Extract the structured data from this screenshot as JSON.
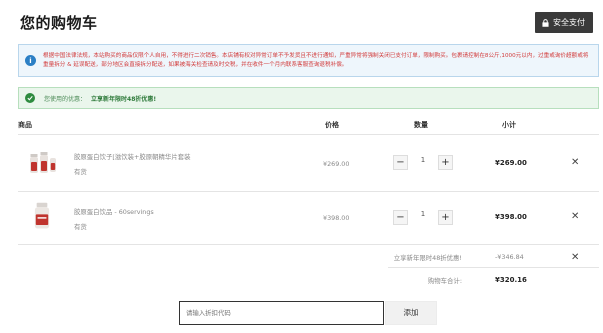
{
  "header": {
    "title": "您的购物车",
    "checkout_label": "安全支付"
  },
  "notice": {
    "icon": "info-icon",
    "text": "根据中国法律法规，本站购买的商品仅限个人自用，不得进行二次销售。本店铺有权对异常订单不予发货且不进行通知，严重异常将强制关闭已支付订单，限制购买。包裹请控制在8公斤,1000元以内，过重或询价超额或将重量拆分 & 延误配送，部分地区会直接拆分配送，如果被海关检查请及时交税，并在收件一个月内联系客服查询退税补偿。"
  },
  "coupon_message": {
    "label": "您使用的优惠：",
    "code": "立享新年限时48折优惠!"
  },
  "table": {
    "headers": {
      "product": "商品",
      "price": "价格",
      "quantity": "数量",
      "subtotal": "小计"
    }
  },
  "items": [
    {
      "name": "胶原蛋白饮子[滋饮装+胶原朝精华片套装",
      "meta": "有货",
      "price": "¥269.00",
      "quantity": "1",
      "subtotal": "¥269.00",
      "thumb_color": "#c0342e"
    },
    {
      "name": "胶原蛋白饮品 - 60servings",
      "meta": "有货",
      "price": "¥398.00",
      "quantity": "1",
      "subtotal": "¥398.00",
      "thumb_color": "#c0342e"
    }
  ],
  "summary": {
    "discount_label": "立享新年限时48折优惠!",
    "discount_value": "-¥346.84",
    "total_label": "购物车合计:",
    "total_value": "¥320.16"
  },
  "promo": {
    "placeholder": "请输入折扣代码",
    "apply_label": "添加"
  },
  "controls": {
    "minus": "−",
    "plus": "+",
    "remove": "✕"
  }
}
